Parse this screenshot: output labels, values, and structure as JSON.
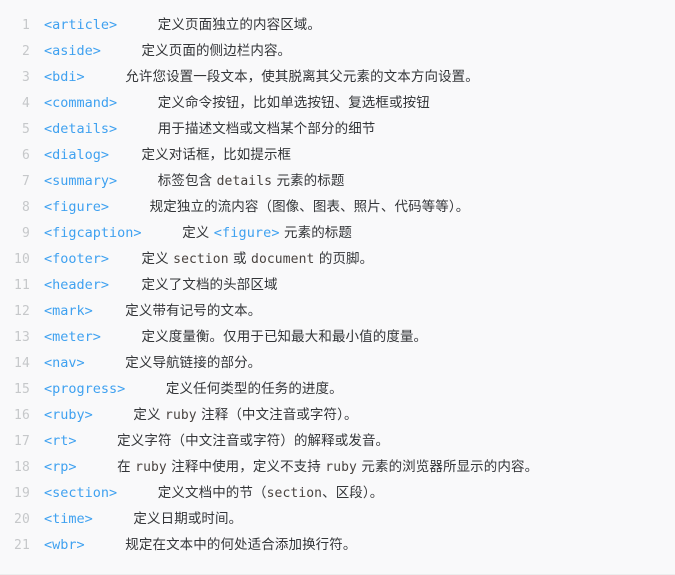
{
  "listing": {
    "background_color": "#f9f9fa",
    "line_number_color": "#c6c8ca",
    "tag_color": "#3fa1f0",
    "text_color": "#333538",
    "inline_code_color": "#4a4440",
    "lines": [
      {
        "number": "1",
        "tag": "<article>",
        "gap": "     ",
        "parts": [
          {
            "type": "text",
            "text": "定义页面独立的内容区域。"
          }
        ]
      },
      {
        "number": "2",
        "tag": "<aside>",
        "gap": "     ",
        "parts": [
          {
            "type": "text",
            "text": "定义页面的侧边栏内容。"
          }
        ]
      },
      {
        "number": "3",
        "tag": "<bdi>",
        "gap": "     ",
        "parts": [
          {
            "type": "text",
            "text": "允许您设置一段文本，使其脱离其父元素的文本方向设置。"
          }
        ]
      },
      {
        "number": "4",
        "tag": "<command>",
        "gap": "     ",
        "parts": [
          {
            "type": "text",
            "text": "定义命令按钮，比如单选按钮、复选框或按钮"
          }
        ]
      },
      {
        "number": "5",
        "tag": "<details>",
        "gap": "     ",
        "parts": [
          {
            "type": "text",
            "text": "用于描述文档或文档某个部分的细节"
          }
        ]
      },
      {
        "number": "6",
        "tag": "<dialog>",
        "gap": "    ",
        "parts": [
          {
            "type": "text",
            "text": "定义对话框，比如提示框"
          }
        ]
      },
      {
        "number": "7",
        "tag": "<summary>",
        "gap": "     ",
        "parts": [
          {
            "type": "text",
            "text": "标签包含 "
          },
          {
            "type": "code",
            "text": "details"
          },
          {
            "type": "text",
            "text": " 元素的标题"
          }
        ]
      },
      {
        "number": "8",
        "tag": "<figure>",
        "gap": "     ",
        "parts": [
          {
            "type": "text",
            "text": "规定独立的流内容（图像、图表、照片、代码等等）。"
          }
        ]
      },
      {
        "number": "9",
        "tag": "<figcaption>",
        "gap": "     ",
        "parts": [
          {
            "type": "text",
            "text": "定义 "
          },
          {
            "type": "tag",
            "text": "<figure>"
          },
          {
            "type": "text",
            "text": " 元素的标题"
          }
        ]
      },
      {
        "number": "10",
        "tag": "<footer>",
        "gap": "    ",
        "parts": [
          {
            "type": "text",
            "text": "定义 "
          },
          {
            "type": "code",
            "text": "section"
          },
          {
            "type": "text",
            "text": " 或 "
          },
          {
            "type": "code",
            "text": "document"
          },
          {
            "type": "text",
            "text": " 的页脚。"
          }
        ]
      },
      {
        "number": "11",
        "tag": "<header>",
        "gap": "    ",
        "parts": [
          {
            "type": "text",
            "text": "定义了文档的头部区域"
          }
        ]
      },
      {
        "number": "12",
        "tag": "<mark>",
        "gap": "    ",
        "parts": [
          {
            "type": "text",
            "text": "定义带有记号的文本。"
          }
        ]
      },
      {
        "number": "13",
        "tag": "<meter>",
        "gap": "     ",
        "parts": [
          {
            "type": "text",
            "text": "定义度量衡。仅用于已知最大和最小值的度量。"
          }
        ]
      },
      {
        "number": "14",
        "tag": "<nav>",
        "gap": "     ",
        "parts": [
          {
            "type": "text",
            "text": "定义导航链接的部分。"
          }
        ]
      },
      {
        "number": "15",
        "tag": "<progress>",
        "gap": "     ",
        "parts": [
          {
            "type": "text",
            "text": "定义任何类型的任务的进度。"
          }
        ]
      },
      {
        "number": "16",
        "tag": "<ruby>",
        "gap": "     ",
        "parts": [
          {
            "type": "text",
            "text": "定义 "
          },
          {
            "type": "code",
            "text": "ruby"
          },
          {
            "type": "text",
            "text": " 注释（中文注音或字符）。"
          }
        ]
      },
      {
        "number": "17",
        "tag": "<rt>",
        "gap": "     ",
        "parts": [
          {
            "type": "text",
            "text": "定义字符（中文注音或字符）的解释或发音。"
          }
        ]
      },
      {
        "number": "18",
        "tag": "<rp>",
        "gap": "     ",
        "parts": [
          {
            "type": "text",
            "text": "在 "
          },
          {
            "type": "code",
            "text": "ruby"
          },
          {
            "type": "text",
            "text": " 注释中使用，定义不支持 "
          },
          {
            "type": "code",
            "text": "ruby"
          },
          {
            "type": "text",
            "text": " 元素的浏览器所显示的内容。"
          }
        ]
      },
      {
        "number": "19",
        "tag": "<section>",
        "gap": "     ",
        "parts": [
          {
            "type": "text",
            "text": "定义文档中的节（"
          },
          {
            "type": "code",
            "text": "section"
          },
          {
            "type": "text",
            "text": "、区段）。"
          }
        ]
      },
      {
        "number": "20",
        "tag": "<time>",
        "gap": "     ",
        "parts": [
          {
            "type": "text",
            "text": "定义日期或时间。"
          }
        ]
      },
      {
        "number": "21",
        "tag": "<wbr>",
        "gap": "     ",
        "parts": [
          {
            "type": "text",
            "text": "规定在文本中的何处适合添加换行符。"
          }
        ]
      }
    ]
  }
}
